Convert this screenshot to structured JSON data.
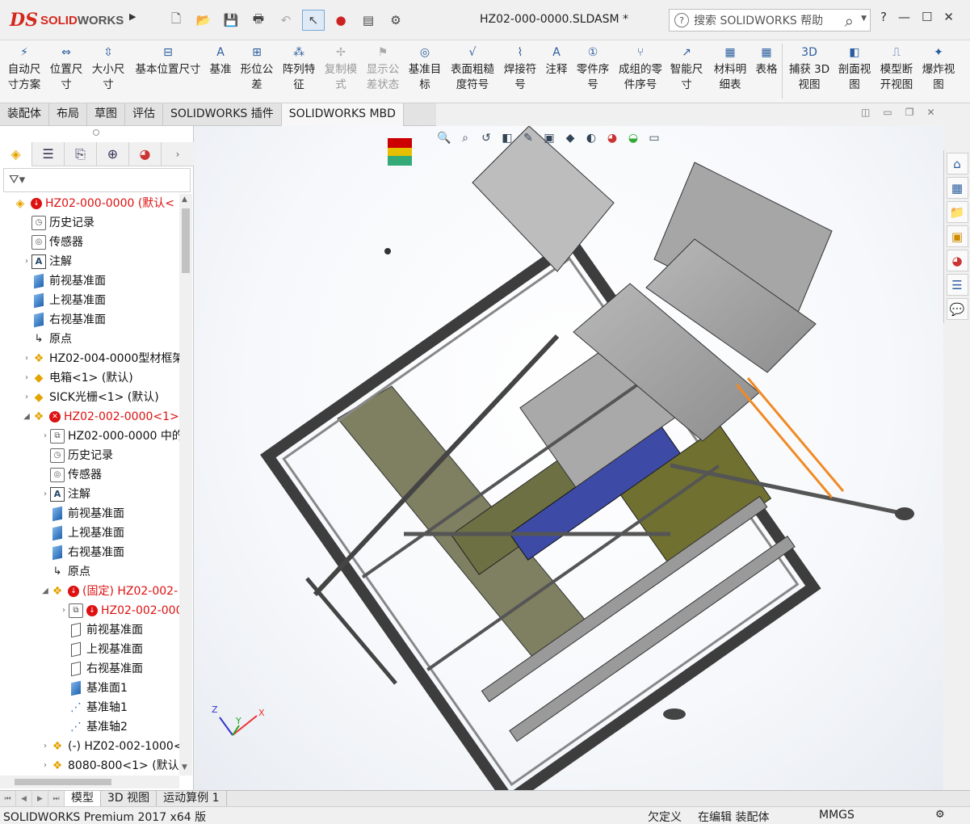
{
  "app": {
    "logo_prefix": "DS",
    "logo_text_a": "SOLID",
    "logo_text_b": "WORKS",
    "document_title": "HZ02-000-0000.SLDASM *",
    "search_placeholder": "搜索 SOLIDWORKS 帮助"
  },
  "ribbon": {
    "buttons": [
      {
        "label1": "自动尺",
        "label2": "寸方案",
        "icon": "auto-dimension-icon"
      },
      {
        "label1": "位置尺",
        "label2": "寸",
        "icon": "location-dimension-icon"
      },
      {
        "label1": "大小尺",
        "label2": "寸",
        "icon": "size-dimension-icon"
      },
      {
        "label1": "基本位置尺寸",
        "label2": "",
        "icon": "basic-location-dimension-icon"
      },
      {
        "label1": "基准",
        "label2": "",
        "icon": "datum-icon"
      },
      {
        "label1": "形位公",
        "label2": "差",
        "icon": "geometric-tolerance-icon"
      },
      {
        "label1": "阵列特",
        "label2": "征",
        "icon": "pattern-feature-icon"
      },
      {
        "label1": "复制模",
        "label2": "式",
        "icon": "copy-scheme-icon",
        "disabled": true
      },
      {
        "label1": "显示公",
        "label2": "差状态",
        "icon": "show-tolerance-status-icon",
        "disabled": true
      },
      {
        "label1": "基准目",
        "label2": "标",
        "icon": "datum-target-icon"
      },
      {
        "label1": "表面粗糙",
        "label2": "度符号",
        "icon": "surface-finish-icon"
      },
      {
        "label1": "焊接符",
        "label2": "号",
        "icon": "weld-symbol-icon"
      },
      {
        "label1": "注释",
        "label2": "",
        "icon": "note-icon"
      },
      {
        "label1": "零件序",
        "label2": "号",
        "icon": "balloon-icon"
      },
      {
        "label1": "成组的零",
        "label2": "件序号",
        "icon": "stacked-balloon-icon"
      },
      {
        "label1": "智能尺",
        "label2": "寸",
        "icon": "smart-dimension-icon"
      },
      {
        "label1": "材料明",
        "label2": "细表",
        "icon": "bom-icon"
      },
      {
        "label1": "表格",
        "label2": "",
        "icon": "table-icon"
      },
      {
        "label1": "捕获 3D",
        "label2": "视图",
        "icon": "capture-3d-view-icon"
      },
      {
        "label1": "剖面视",
        "label2": "图",
        "icon": "section-view-icon"
      },
      {
        "label1": "模型断",
        "label2": "开视图",
        "icon": "model-break-view-icon"
      },
      {
        "label1": "爆炸视",
        "label2": "图",
        "icon": "exploded-view-icon"
      }
    ]
  },
  "tabs": [
    "装配体",
    "布局",
    "草图",
    "评估",
    "SOLIDWORKS 插件",
    "SOLIDWORKS MBD"
  ],
  "active_tab": "SOLIDWORKS MBD",
  "tree": {
    "items": [
      {
        "label": "HZ02-000-0000  (默认<",
        "indent": 0,
        "icon": "assembly-icon",
        "status": "down",
        "red": true
      },
      {
        "label": "历史记录",
        "indent": 1,
        "icon": "history-icon"
      },
      {
        "label": "传感器",
        "indent": 1,
        "icon": "sensor-icon"
      },
      {
        "label": "注解",
        "indent": 1,
        "icon": "annotation-icon",
        "expand": true
      },
      {
        "label": "前视基准面",
        "indent": 1,
        "icon": "plane-icon"
      },
      {
        "label": "上视基准面",
        "indent": 1,
        "icon": "plane-icon"
      },
      {
        "label": "右视基准面",
        "indent": 1,
        "icon": "plane-icon"
      },
      {
        "label": "原点",
        "indent": 1,
        "icon": "origin-icon"
      },
      {
        "label": "HZ02-004-0000型材框架",
        "indent": 1,
        "icon": "subassembly-icon",
        "expand": true
      },
      {
        "label": "电箱<1> (默认)",
        "indent": 1,
        "icon": "part-icon",
        "expand": true
      },
      {
        "label": "SICK光栅<1> (默认)",
        "indent": 1,
        "icon": "part-icon",
        "expand": true
      },
      {
        "label": "HZ02-002-0000<1>",
        "indent": 1,
        "icon": "subassembly-icon",
        "status": "error",
        "red": true,
        "expanded": true
      },
      {
        "label": "HZ02-000-0000 中的",
        "indent": 2,
        "icon": "folder-icon",
        "expand": true
      },
      {
        "label": "历史记录",
        "indent": 2,
        "icon": "history-icon"
      },
      {
        "label": "传感器",
        "indent": 2,
        "icon": "sensor-icon"
      },
      {
        "label": "注解",
        "indent": 2,
        "icon": "annotation-icon",
        "expand": true
      },
      {
        "label": "前视基准面",
        "indent": 2,
        "icon": "plane-icon"
      },
      {
        "label": "上视基准面",
        "indent": 2,
        "icon": "plane-icon"
      },
      {
        "label": "右视基准面",
        "indent": 2,
        "icon": "plane-icon"
      },
      {
        "label": "原点",
        "indent": 2,
        "icon": "origin-icon"
      },
      {
        "label": "(固定) HZ02-002-",
        "indent": 2,
        "icon": "subassembly-icon",
        "status": "down",
        "red": true,
        "expanded": true
      },
      {
        "label": "HZ02-002-000",
        "indent": 3,
        "icon": "folder-icon",
        "status": "down",
        "red": true,
        "expand": true
      },
      {
        "label": "前视基准面",
        "indent": 3,
        "icon": "plane-outline-icon"
      },
      {
        "label": "上视基准面",
        "indent": 3,
        "icon": "plane-outline-icon"
      },
      {
        "label": "右视基准面",
        "indent": 3,
        "icon": "plane-outline-icon"
      },
      {
        "label": "基准面1",
        "indent": 3,
        "icon": "plane-icon"
      },
      {
        "label": "基准轴1",
        "indent": 3,
        "icon": "axis-icon"
      },
      {
        "label": "基准轴2",
        "indent": 3,
        "icon": "axis-icon"
      },
      {
        "label": "(-) HZ02-002-1000<",
        "indent": 2,
        "icon": "subassembly-icon",
        "expand": true
      },
      {
        "label": "8080-800<1> (默认)",
        "indent": 2,
        "icon": "subassembly-icon",
        "expand": true
      }
    ]
  },
  "bottom_tabs": [
    "模型",
    "3D 视图",
    "运动算例 1"
  ],
  "active_bottom_tab": "模型",
  "status": {
    "product": "SOLIDWORKS Premium 2017 x64 版",
    "definition": "欠定义",
    "mode": "在编辑 装配体",
    "units": "MMGS"
  },
  "triad": {
    "x": "X",
    "y": "Y",
    "z": "Z"
  },
  "colors": {
    "brand": "#d4281e",
    "accent": "#2a5d9e",
    "error": "#d11111"
  }
}
